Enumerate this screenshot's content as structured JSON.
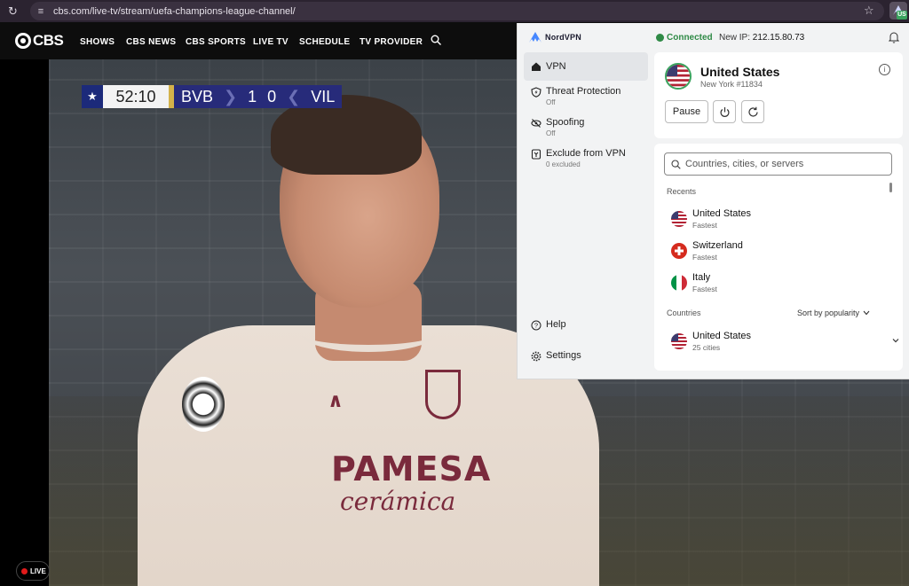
{
  "browser": {
    "url": "cbs.com/live-tv/stream/uefa-champions-league-channel/",
    "extension_badge": "US"
  },
  "cbs": {
    "logo_text": "CBS",
    "nav": [
      "SHOWS",
      "CBS NEWS",
      "CBS SPORTS",
      "LIVE TV",
      "SCHEDULE",
      "TV PROVIDER"
    ]
  },
  "scoreboard": {
    "clock": "52:10",
    "home": "BVB",
    "home_score": "1",
    "away_score": "0",
    "away": "VIL"
  },
  "video": {
    "sponsor_line1": "PAMESA",
    "sponsor_line2": "cerámica",
    "live_label": "LIVE"
  },
  "nordvpn": {
    "brand": "NordVPN",
    "status": "Connected",
    "new_ip_label": "New IP:",
    "new_ip": "212.15.80.73",
    "sidebar": [
      {
        "label": "VPN",
        "sub": ""
      },
      {
        "label": "Threat Protection",
        "sub": "Off"
      },
      {
        "label": "Spoofing",
        "sub": "Off"
      },
      {
        "label": "Exclude from VPN",
        "sub": "0 excluded"
      }
    ],
    "help": "Help",
    "settings": "Settings",
    "current": {
      "country": "United States",
      "server": "New York #11834",
      "pause": "Pause"
    },
    "search_placeholder": "Countries, cities, or servers",
    "recents_label": "Recents",
    "recents": [
      {
        "name": "United States",
        "sub": "Fastest"
      },
      {
        "name": "Switzerland",
        "sub": "Fastest"
      },
      {
        "name": "Italy",
        "sub": "Fastest"
      }
    ],
    "countries_label": "Countries",
    "sort_label": "Sort by popularity",
    "countries": [
      {
        "name": "United States",
        "sub": "25 cities"
      }
    ]
  }
}
